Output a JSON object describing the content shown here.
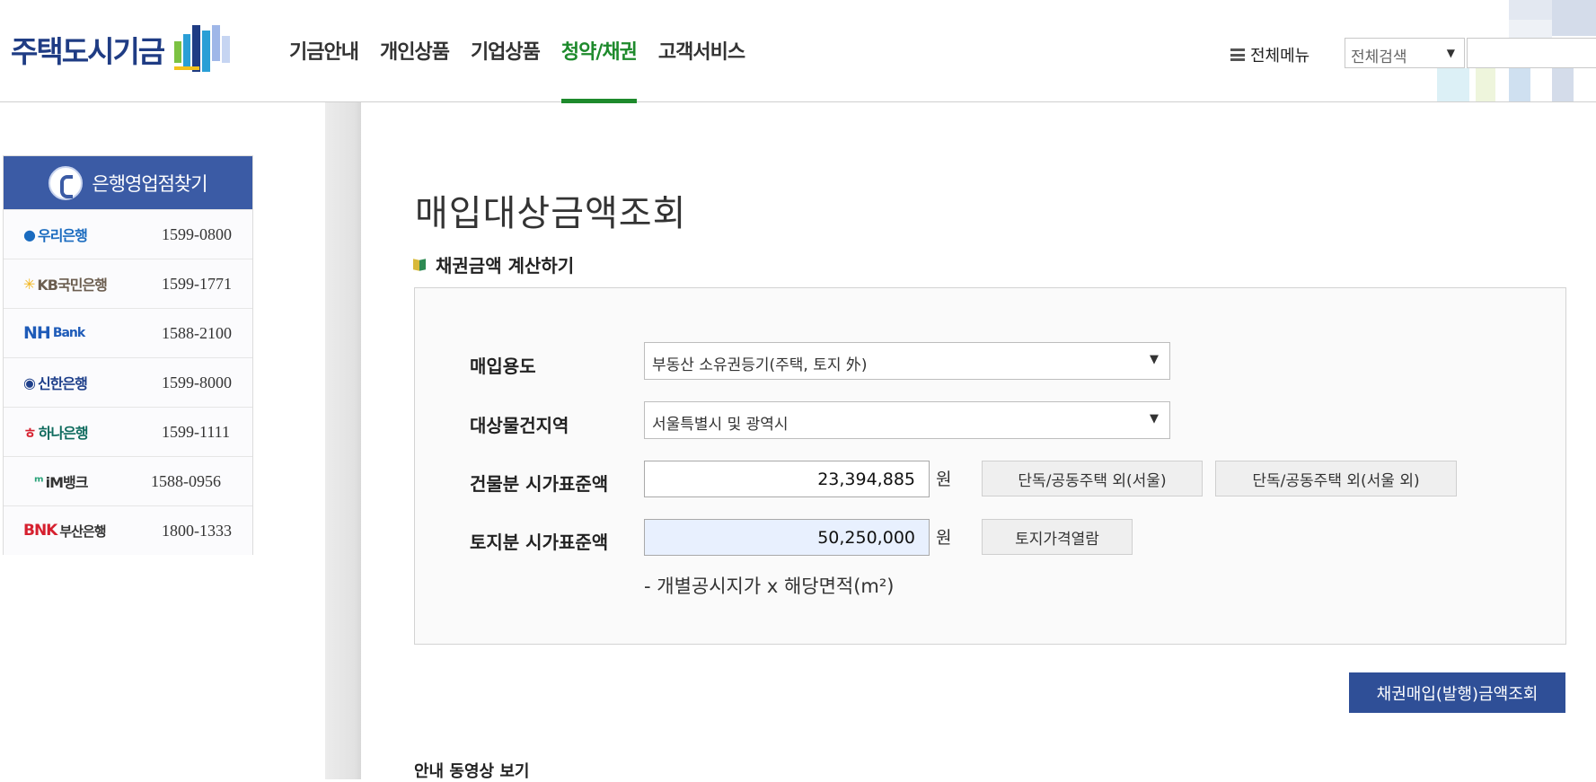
{
  "header": {
    "logo_text": "주택도시기금",
    "nav": [
      {
        "label": "기금안내",
        "active": false
      },
      {
        "label": "개인상품",
        "active": false
      },
      {
        "label": "기업상품",
        "active": false
      },
      {
        "label": "청약/채권",
        "active": true
      },
      {
        "label": "고객서비스",
        "active": false
      }
    ],
    "all_menu_label": "전체메뉴",
    "search_scope": "전체검색",
    "search_value": ""
  },
  "sidebar": {
    "title": "은행영업점찾기",
    "banks": [
      {
        "name": "우리은행",
        "mark": "●",
        "phone": "1599-0800",
        "color": "#1a6bbf"
      },
      {
        "name": "KB국민은행",
        "mark": "✳",
        "phone": "1599-1771",
        "color": "#6b5d4f"
      },
      {
        "name": "Bank",
        "mark": "NH",
        "phone": "1588-2100",
        "color": "#1e5bb8"
      },
      {
        "name": "신한은행",
        "mark": "◉",
        "phone": "1599-8000",
        "color": "#1e3f8a"
      },
      {
        "name": "하나은행",
        "mark": "ㅎ",
        "phone": "1599-1111",
        "color": "#0f6b5e"
      },
      {
        "name": "iM뱅크",
        "mark": "ᵐ",
        "phone": "1588-0956",
        "color": "#2aa37a"
      },
      {
        "name": "부산은행",
        "mark": "BNK",
        "phone": "1800-1333",
        "color": "#d6202f"
      }
    ]
  },
  "main": {
    "page_title": "매입대상금액조회",
    "section_title": "채권금액 계산하기",
    "form": {
      "purpose_label": "매입용도",
      "purpose_value": "부동산 소유권등기(주택, 토지 外)",
      "region_label": "대상물건지역",
      "region_value": "서울특별시 및 광역시",
      "building_label": "건물분 시가표준액",
      "building_value": "23,394,885",
      "land_label": "토지분 시가표준액",
      "land_value": "50,250,000",
      "unit": "원",
      "btn_house_seoul": "단독/공동주택 외(서울)",
      "btn_house_other": "단독/공동주택 외(서울 외)",
      "btn_land_price": "토지가격열람",
      "note": "- 개별공시지가 x 해당면적(m²)"
    },
    "submit_label": "채권매입(발행)금액조회",
    "video_title": "안내 동영상 보기"
  },
  "colors": {
    "brand_blue": "#3b5ba5",
    "nav_active_green": "#1e8a2c",
    "primary_button": "#2f4f97"
  }
}
